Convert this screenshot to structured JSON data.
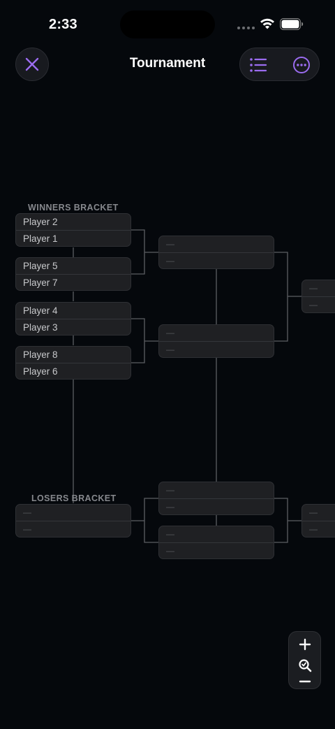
{
  "status_bar": {
    "time": "2:33"
  },
  "header": {
    "title": "Tournament"
  },
  "bracket": {
    "winners_label": "WINNERS BRACKET",
    "losers_label": "LOSERS BRACKET",
    "winners_round1": [
      {
        "top": "Player 2",
        "bottom": "Player 1"
      },
      {
        "top": "Player 5",
        "bottom": "Player 7"
      },
      {
        "top": "Player 4",
        "bottom": "Player 3"
      },
      {
        "top": "Player 8",
        "bottom": "Player 6"
      }
    ],
    "placeholder": "—"
  },
  "colors": {
    "accent": "#9b6cf0",
    "background": "#05080c",
    "card": "#1f2023"
  },
  "icons": {
    "close": "close-icon",
    "list": "list-icon",
    "more": "more-icon",
    "zoom_in": "plus-icon",
    "zoom_fit": "zoom-fit-icon",
    "zoom_out": "minus-icon"
  }
}
